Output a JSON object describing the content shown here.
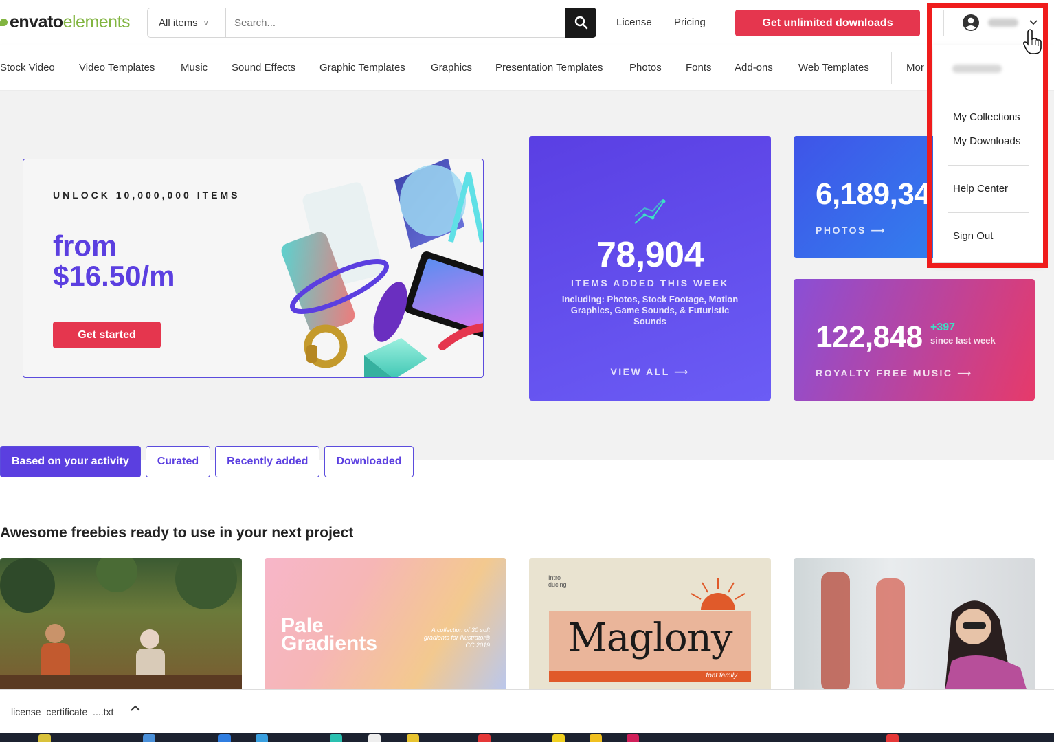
{
  "header": {
    "logo_part1": "envato",
    "logo_part2": "elements",
    "category_select": "All items",
    "search_placeholder": "Search...",
    "license_link": "License",
    "pricing_link": "Pricing",
    "cta_label": "Get unlimited downloads"
  },
  "nav": {
    "items": [
      "Stock Video",
      "Video Templates",
      "Music",
      "Sound Effects",
      "Graphic Templates",
      "Graphics",
      "Presentation Templates",
      "Photos",
      "Fonts",
      "Add-ons",
      "Web Templates"
    ],
    "more_label": "Mor"
  },
  "promo": {
    "kicker": "UNLOCK 10,000,000 ITEMS",
    "price_line1": "from",
    "price_line2": "$16.50/m",
    "button": "Get started"
  },
  "stats": {
    "main": {
      "number": "78,904",
      "caption": "ITEMS ADDED THIS WEEK",
      "description": "Including: Photos, Stock Footage, Motion Graphics, Game Sounds, & Futuristic Sounds",
      "link": "VIEW ALL"
    },
    "photos": {
      "number": "6,189,34",
      "caption": "PHOTOS"
    },
    "music": {
      "number": "122,848",
      "delta": "+397",
      "delta_note": "since last week",
      "caption": "ROYALTY FREE MUSIC"
    }
  },
  "tabs": [
    {
      "label": "Based on your activity",
      "active": true
    },
    {
      "label": "Curated",
      "active": false
    },
    {
      "label": "Recently added",
      "active": false
    },
    {
      "label": "Downloaded",
      "active": false
    }
  ],
  "section": {
    "title": "Awesome freebies ready to use in your next project"
  },
  "thumbs": {
    "pale_title1": "Pale",
    "pale_title2": "Gradients",
    "pale_note": "A collection of 30 soft gradients for Illustrator® CC 2019",
    "font_intro": "Intro ducing",
    "font_name": "Maglony",
    "font_sub": "font family"
  },
  "account_menu": {
    "items": [
      "My Collections",
      "My Downloads",
      "Help Center",
      "Sign Out"
    ]
  },
  "download_bar": {
    "filename": "license_certificate_....txt"
  },
  "colors": {
    "accent": "#5b3fe0",
    "cta": "#e5364e",
    "highlight": "#ef1c1c",
    "brand_green": "#82b541"
  }
}
